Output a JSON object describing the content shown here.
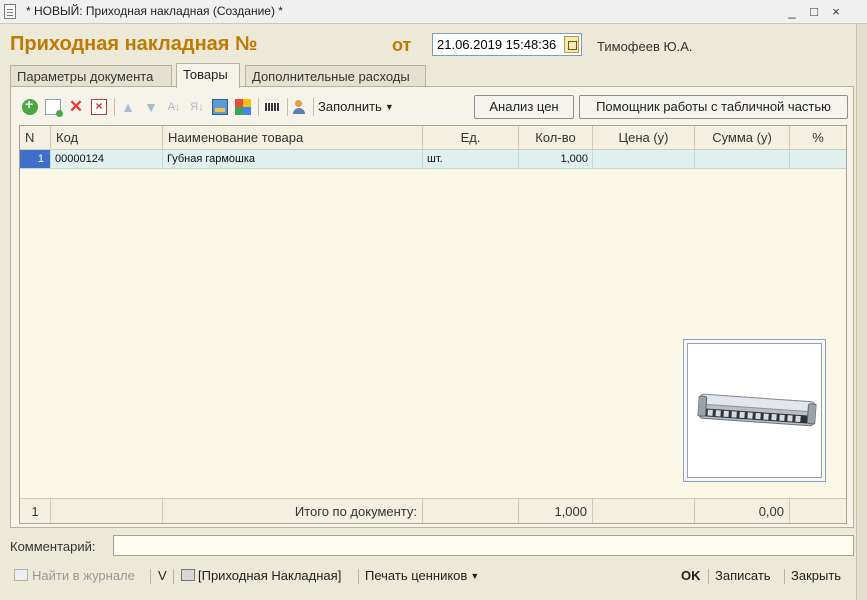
{
  "window": {
    "title": "* НОВЫЙ: Приходная накладная (Создание) *",
    "minimize_glyph": "_",
    "maximize_glyph": "□",
    "close_glyph": "×"
  },
  "header": {
    "form_title": "Приходная накладная №",
    "date_label": "от",
    "date_value": "21.06.2019 15:48:36",
    "author": "Тимофеев Ю.А."
  },
  "tabs": [
    {
      "label": "Параметры документа",
      "active": false
    },
    {
      "label": "Товары",
      "active": true
    },
    {
      "label": "Дополнительные расходы",
      "active": false
    }
  ],
  "toolbar": {
    "fill_label": "Заполнить",
    "price_analysis_label": "Анализ цен",
    "table_helper_label": "Помощник работы с табличной частью",
    "icons": [
      "add-icon",
      "copy-icon",
      "delete-icon",
      "mark-delete-icon",
      "move-up-icon",
      "move-down-icon",
      "sort-asc-icon",
      "sort-desc-icon",
      "picker-icon",
      "colors-icon",
      "barcode-icon",
      "user-icon"
    ]
  },
  "grid": {
    "columns": [
      "N",
      "Код",
      "Наименование товара",
      "Ед.",
      "Кол-во",
      "Цена (у)",
      "Сумма (у)",
      "%"
    ],
    "rows": [
      {
        "n": "1",
        "code": "00000124",
        "name": "Губная гармошка",
        "unit": "шт.",
        "qty": "1,000",
        "price": "",
        "sum": "",
        "pct": ""
      }
    ],
    "footer": {
      "count": "1",
      "total_label": "Итого по документу:",
      "qty_total": "1,000",
      "sum_total": "0,00"
    }
  },
  "comment": {
    "label": "Комментарий:",
    "value": ""
  },
  "bottom_bar": {
    "find_in_journal": "Найти в журнале",
    "v_label": "V",
    "print_doc": "[Приходная Накладная]",
    "print_labels": "Печать ценников",
    "ok": "OK",
    "save": "Записать",
    "close": "Закрыть"
  },
  "colors": {
    "title_accent": "#C07A00",
    "selected_row_number": "#3F6FCB",
    "row_highlight": "#DFF0EE"
  }
}
